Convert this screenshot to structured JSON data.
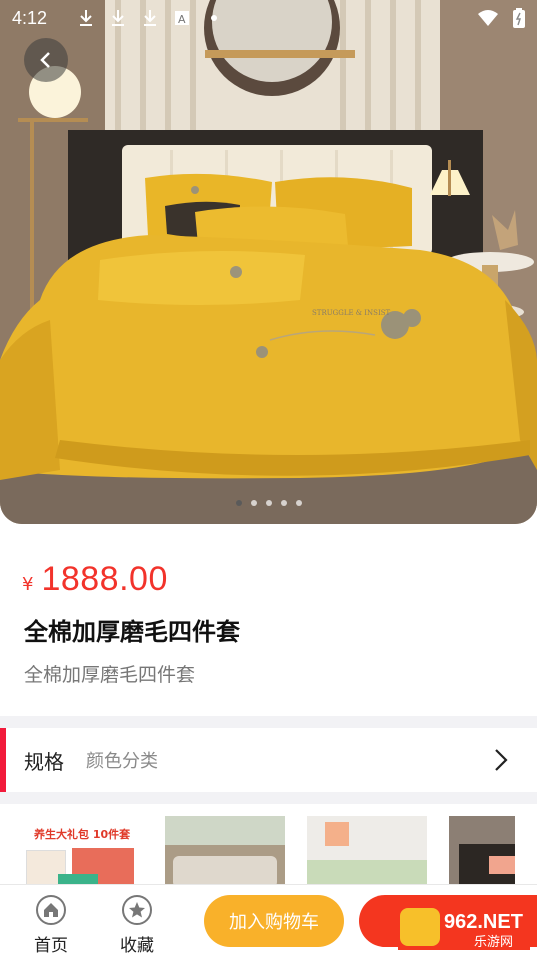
{
  "status_bar": {
    "time": "4:12",
    "icons": [
      "download-icon",
      "download-icon",
      "download-icon",
      "text-a-icon",
      "dot-icon"
    ],
    "right_icons": [
      "wifi-icon",
      "battery-icon"
    ]
  },
  "gallery": {
    "page_count": 5,
    "current_page": 1
  },
  "product": {
    "currency": "¥",
    "price": "1888.00",
    "title": "全棉加厚磨毛四件套",
    "subtitle": "全棉加厚磨毛四件套"
  },
  "spec": {
    "label": "规格",
    "value": "颜色分类"
  },
  "thumbnails": {
    "first_banner_text": "养生大礼包 10件套"
  },
  "bottom_bar": {
    "home_label": "首页",
    "favorite_label": "收藏",
    "cart_label": "加入购物车"
  },
  "watermark": {
    "brand": "962.NET",
    "sub": "乐游网"
  },
  "colors": {
    "price_red": "#f2332b",
    "spec_accent": "#f21a3b",
    "cart_orange": "#f9b12a",
    "buy_red": "#f4361f",
    "bedding_yellow": "#e8b62c"
  }
}
